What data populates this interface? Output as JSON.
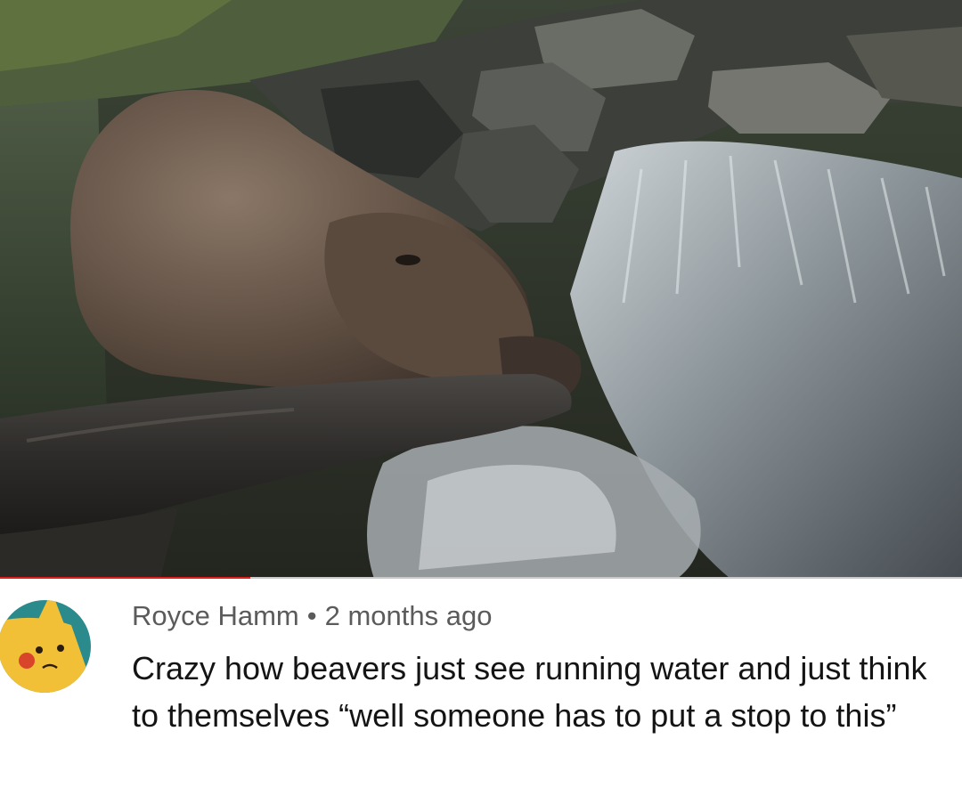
{
  "comment": {
    "author": "Royce Hamm",
    "separator": "•",
    "posted": "2 months ago",
    "text": "Crazy how beavers just see running water and just think to themselves “well someone has to put a stop to this”"
  },
  "video": {
    "progress_fraction": 0.26,
    "progress_color": "#e0201c",
    "track_color": "#c9c9c9"
  },
  "avatar": {
    "icon": "pikachu-avatar-icon",
    "ring_color": "#2a8a8c",
    "face_color": "#f2c037"
  }
}
